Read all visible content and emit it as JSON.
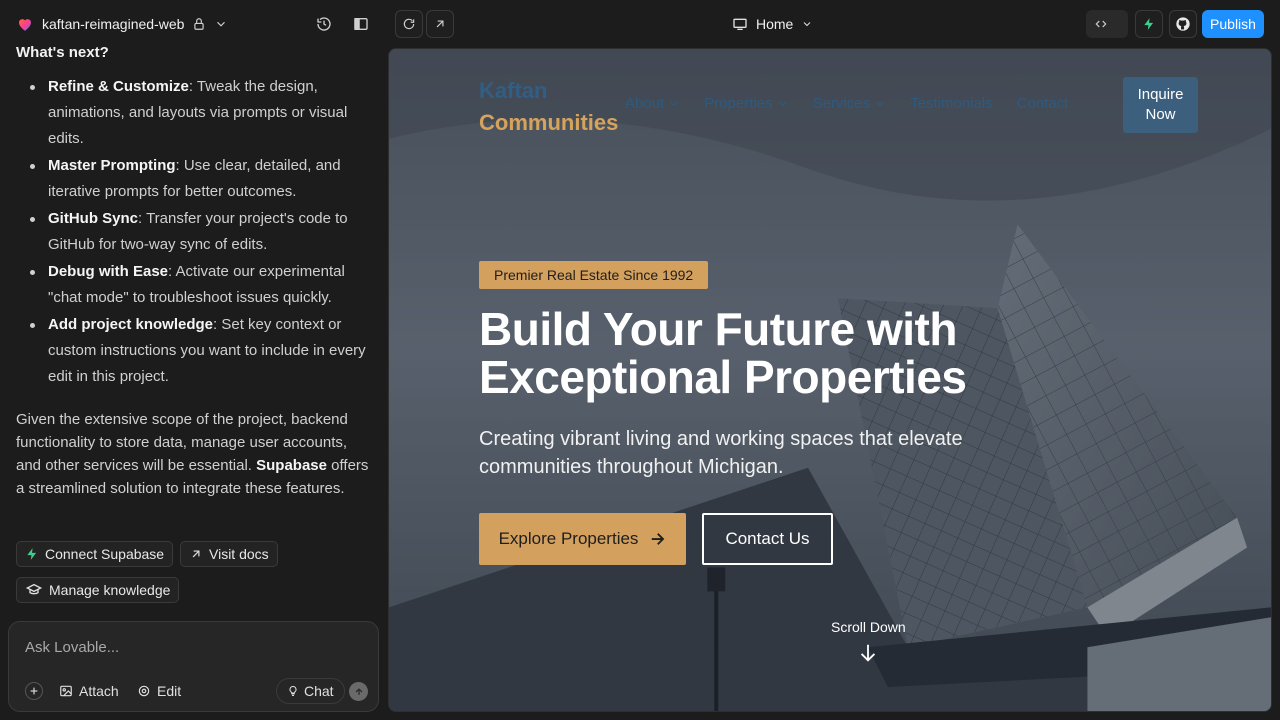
{
  "topbar": {
    "project_name": "kaftan-reimagined-web",
    "route": "Home",
    "publish_label": "Publish"
  },
  "chat": {
    "heading": "What's next?",
    "steps": [
      {
        "title": "Refine & Customize",
        "text": ": Tweak the design, animations, and layouts via prompts or visual edits."
      },
      {
        "title": "Master Prompting",
        "text": ": Use clear, detailed, and iterative prompts for better outcomes."
      },
      {
        "title": "GitHub Sync",
        "text": ": Transfer your project's code to GitHub for two-way sync of edits."
      },
      {
        "title": "Debug with Ease",
        "text": ": Activate our experimental \"chat mode\" to troubleshoot issues quickly."
      },
      {
        "title": "Add project knowledge",
        "text": ": Set key context or custom instructions you want to include in every edit in this project."
      }
    ],
    "para_before": "Given the extensive scope of the project, backend functionality to store data, manage user accounts, and other services will be essential.",
    "para_bold": "Supabase",
    "para_after": " offers a streamlined solution to integrate these features.",
    "chips": {
      "connect": "Connect Supabase",
      "docs": "Visit docs",
      "knowledge": "Manage knowledge"
    }
  },
  "composer": {
    "placeholder": "Ask Lovable...",
    "attach_label": "Attach",
    "edit_label": "Edit",
    "chat_label": "Chat"
  },
  "site": {
    "brand_line1": "Kaftan",
    "brand_line2": "Communities",
    "nav": [
      "About",
      "Properties",
      "Services",
      "Testimonials",
      "Contact"
    ],
    "inquire_label": "Inquire Now",
    "badge": "Premier Real Estate Since 1992",
    "headline": "Build Your Future with Exceptional Properties",
    "subheadline": "Creating vibrant living and working spaces that elevate communities throughout Michigan.",
    "cta_primary": "Explore Properties",
    "cta_secondary": "Contact Us",
    "scroll_label": "Scroll Down"
  },
  "colors": {
    "accent_gold": "#d4a05e",
    "brand_blue": "#2f5f86",
    "publish_blue": "#1e90ff",
    "supabase_green": "#3ecf8e"
  }
}
